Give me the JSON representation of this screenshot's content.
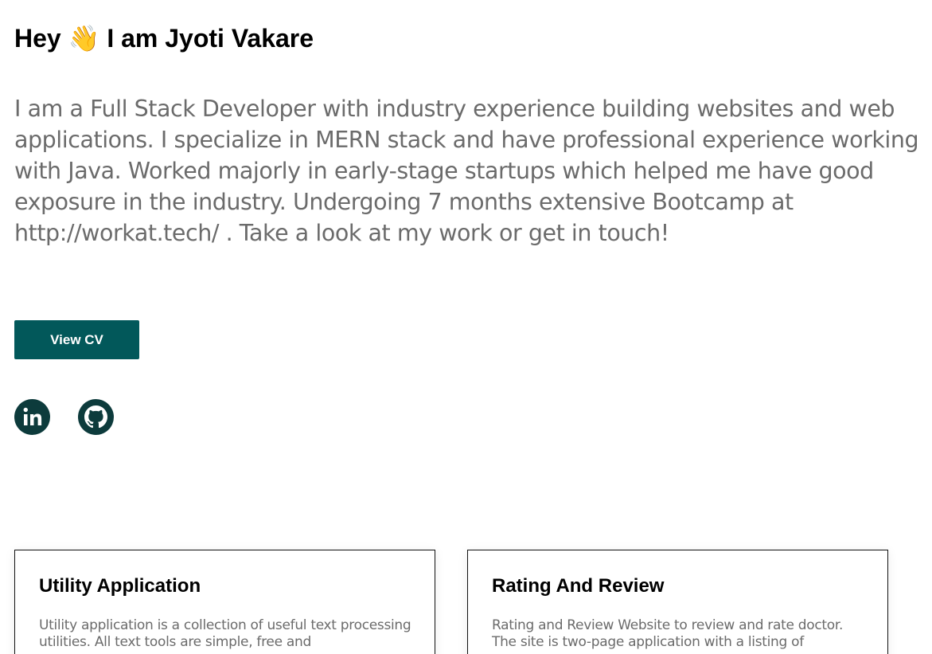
{
  "hero": {
    "greeting": "Hey 👋 I am Jyoti Vakare",
    "intro": "I am a Full Stack Developer with industry experience building websites and web applications. I specialize in MERN stack and have professional experience working with Java. Worked majorly in early-stage startups which helped me have good exposure in the industry. Undergoing 7 months extensive Bootcamp at http://workat.tech/ . Take a look at my work or get in touch!",
    "cv_button": "View CV"
  },
  "socials": [
    {
      "name": "linkedin-icon",
      "color": "#0d3b3c"
    },
    {
      "name": "github-icon",
      "color": "#0d3b3c"
    }
  ],
  "projects": [
    {
      "title": "Utility Application",
      "description": "Utility application is a collection of useful text processing utilities. All text tools are simple, free and"
    },
    {
      "title": "Rating And Review",
      "description": "Rating and Review Website to review and rate doctor. The site is two-page application with a listing of"
    }
  ],
  "colors": {
    "accent": "#02585a",
    "text_muted": "#6b6b6b"
  }
}
